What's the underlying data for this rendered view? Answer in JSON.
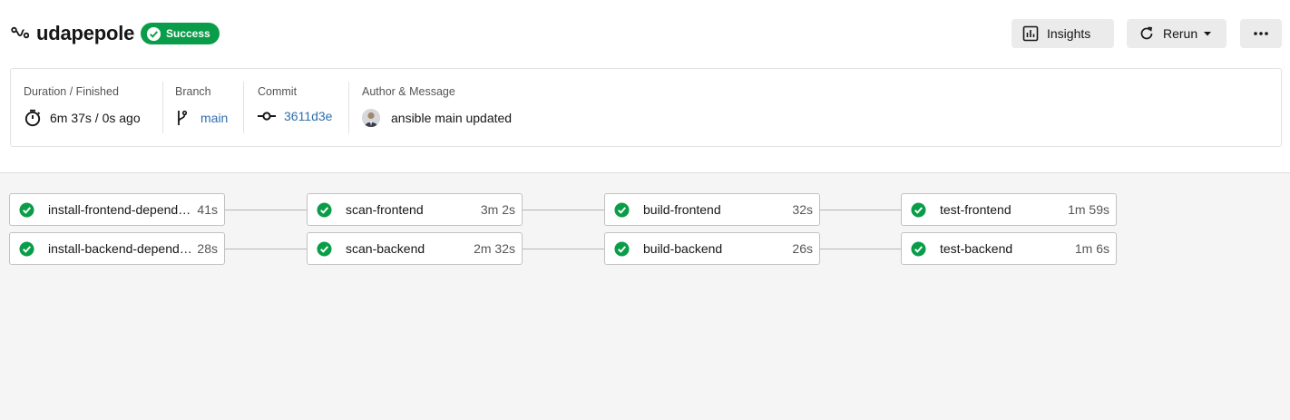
{
  "header": {
    "title": "udapepole",
    "status": "Success",
    "status_color": "#0a9d49",
    "buttons": {
      "insights": "Insights",
      "rerun": "Rerun",
      "more_icon": "more-horizontal-icon"
    }
  },
  "info": {
    "duration": {
      "label": "Duration / Finished",
      "value": "6m 37s / 0s ago",
      "icon": "timer-icon"
    },
    "branch": {
      "label": "Branch",
      "value": "main",
      "icon": "branch-icon"
    },
    "commit": {
      "label": "Commit",
      "value": "3611d3e",
      "icon": "commit-icon"
    },
    "author": {
      "label": "Author & Message",
      "message": "ansible main updated",
      "icon": "avatar"
    }
  },
  "workflow": {
    "rows": [
      [
        {
          "name": "install-frontend-dependencies",
          "duration": "41s",
          "status": "success"
        },
        {
          "name": "scan-frontend",
          "duration": "3m 2s",
          "status": "success"
        },
        {
          "name": "build-frontend",
          "duration": "32s",
          "status": "success"
        },
        {
          "name": "test-frontend",
          "duration": "1m 59s",
          "status": "success"
        }
      ],
      [
        {
          "name": "install-backend-dependencies",
          "duration": "28s",
          "status": "success"
        },
        {
          "name": "scan-backend",
          "duration": "2m 32s",
          "status": "success"
        },
        {
          "name": "build-backend",
          "duration": "26s",
          "status": "success"
        },
        {
          "name": "test-backend",
          "duration": "1m 6s",
          "status": "success"
        }
      ]
    ]
  },
  "colors": {
    "success": "#0a9d49",
    "link": "#2f6fad"
  }
}
